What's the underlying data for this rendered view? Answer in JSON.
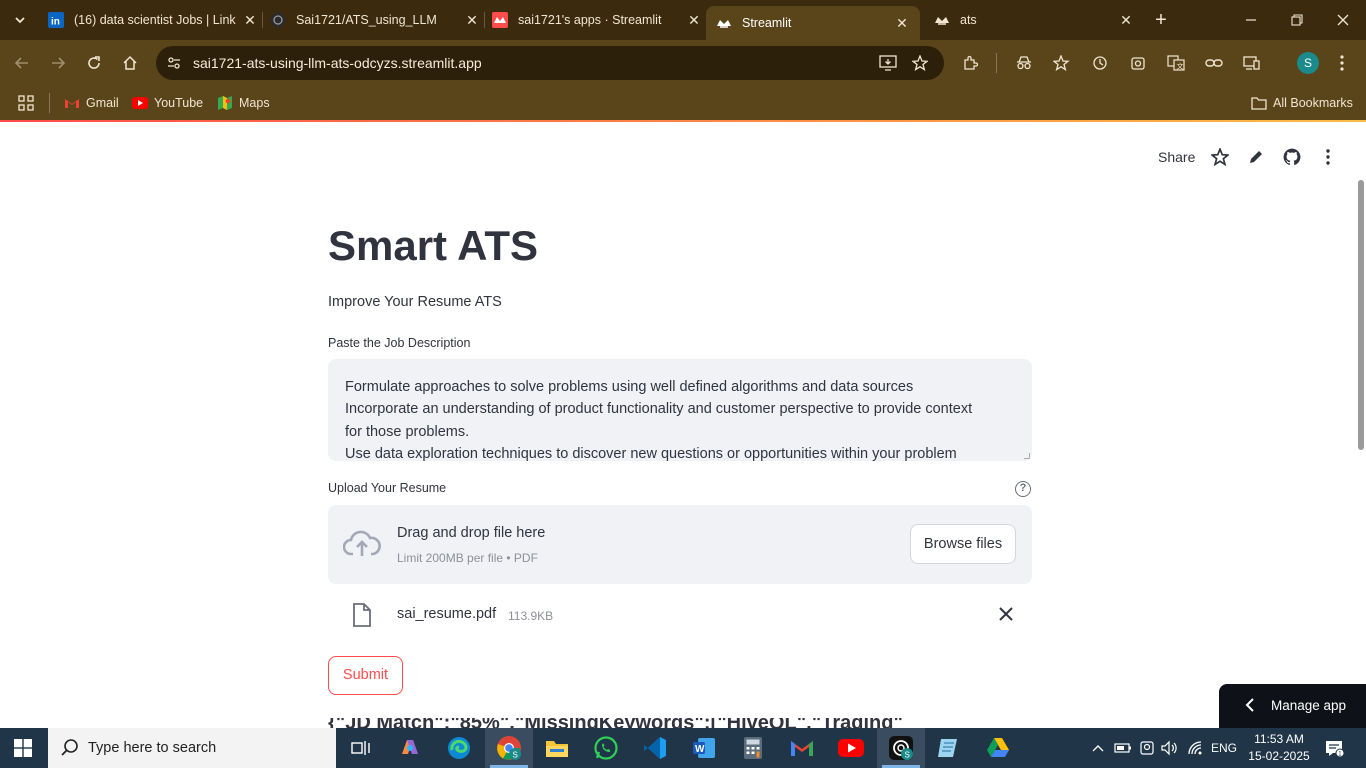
{
  "browser": {
    "tabs": [
      {
        "title": "(16) data scientist Jobs | Link",
        "icon": "linkedin-icon"
      },
      {
        "title": "Sai1721/ATS_using_LLM",
        "icon": "github-icon"
      },
      {
        "title": "sai1721's apps · Streamlit",
        "icon": "streamlit-icon"
      },
      {
        "title": "Streamlit",
        "icon": "streamlit-icon"
      },
      {
        "title": "ats",
        "icon": "streamlit-icon"
      }
    ],
    "active_tab_index": 3,
    "url": "sai1721-ats-using-llm-ats-odcyzs.streamlit.app",
    "profile_initial": "S",
    "bookmarks": [
      {
        "label": "Gmail",
        "icon": "gmail-icon"
      },
      {
        "label": "YouTube",
        "icon": "youtube-icon"
      },
      {
        "label": "Maps",
        "icon": "maps-icon"
      }
    ],
    "all_bookmarks_label": "All Bookmarks"
  },
  "app": {
    "share_label": "Share",
    "title": "Smart ATS",
    "subtitle": "Improve Your Resume ATS",
    "jd_label": "Paste the Job Description",
    "jd_lines": [
      "Formulate approaches to solve problems using well defined algorithms and data sources",
      "Incorporate an understanding of product functionality and customer perspective to provide context",
      "for those problems.",
      "Use data exploration techniques to discover new questions or opportunities within your problem"
    ],
    "upload_label": "Upload Your Resume",
    "dropzone_title": "Drag and drop file here",
    "dropzone_hint": "Limit 200MB per file • PDF",
    "browse_label": "Browse files",
    "file_name": "sai_resume.pdf",
    "file_size": "113.9KB",
    "submit_label": "Submit",
    "partial_heading": "{\"JD Match\":\"85%\",\"MissingKeywords\":[\"HiveQL\",\"Trading\"",
    "manage_label": "Manage app"
  },
  "taskbar": {
    "search_placeholder": "Type here to search",
    "language": "ENG",
    "time": "11:53 AM",
    "date": "15-02-2025",
    "apps": [
      "task-view-icon",
      "copilot-icon",
      "edge-icon",
      "chrome-icon",
      "file-explorer-icon",
      "whatsapp-icon",
      "vscode-icon",
      "word-icon",
      "calculator-icon",
      "gmail-icon",
      "youtube-icon",
      "chatgpt-icon",
      "notepad-icon",
      "google-drive-icon"
    ]
  },
  "colors": {
    "accent": "#ff4b4b",
    "chrome_frame": "#3b2a0e",
    "chrome_toolbar": "#5a4419",
    "text": "#31333f",
    "input_bg": "#f0f2f6"
  }
}
